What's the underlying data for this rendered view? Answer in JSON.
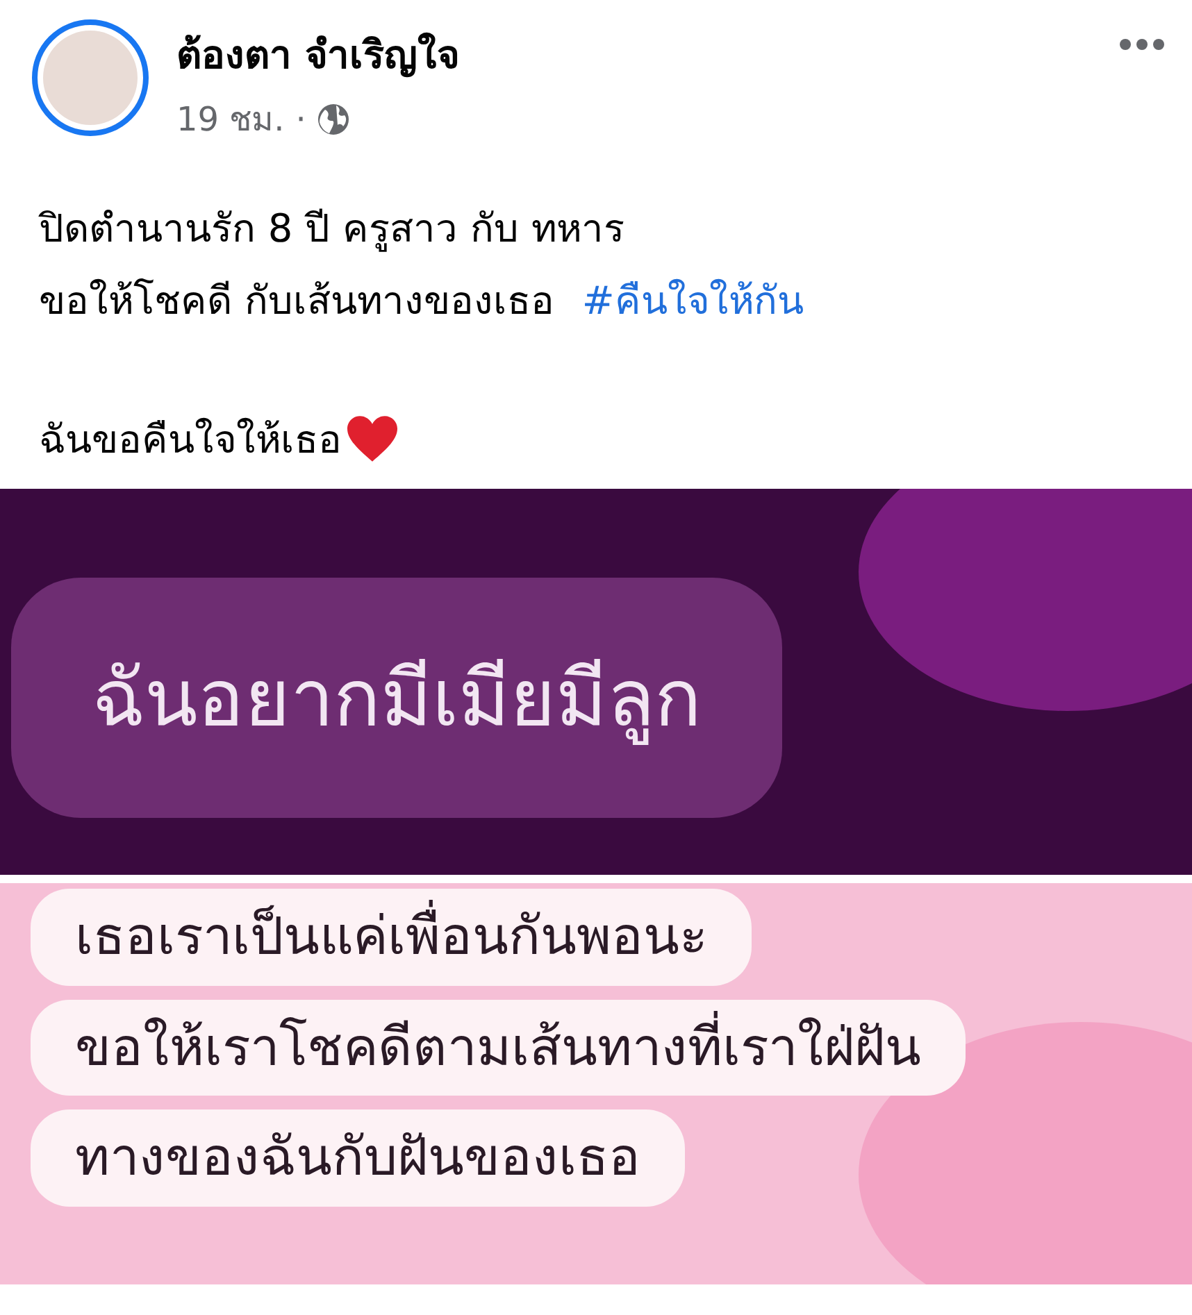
{
  "post": {
    "author": "ต้องตา จำเริญใจ",
    "time": "19 ชม.",
    "separator": "·",
    "paragraphs": [
      [
        {
          "text": "ปิดตำนานรัก 8 ปี  ครูสาว กับ ทหาร"
        },
        {
          "text": "ขอให้โชคดี กับเส้นทางของเธอ",
          "hashtag": "#คืนใจให้กัน"
        }
      ],
      [
        {
          "text": "ฉันขอคืนใจให้เธอ",
          "heart": true
        }
      ]
    ]
  },
  "images": [
    {
      "kind": "dark",
      "messages": [
        "ฉันอยากมีเมียมีลูก"
      ]
    },
    {
      "kind": "light",
      "messages": [
        "เธอเราเป็นแค่เพื่อนกันพอนะ",
        "ขอให้เราโชคดีตามเส้นทางที่เราใฝ่ฝัน",
        "ทางของฉันกับฝันของเธอ"
      ]
    }
  ]
}
